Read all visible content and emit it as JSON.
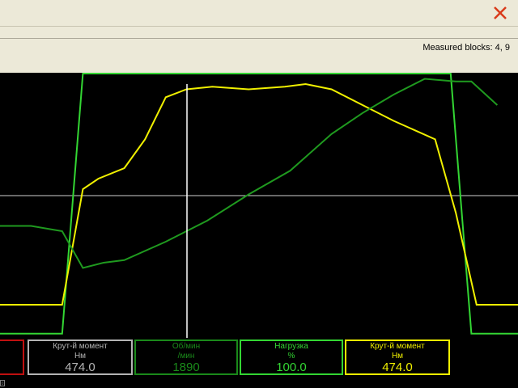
{
  "window": {
    "close_icon": "close-icon",
    "close_color": "#d93a1a"
  },
  "infobar": {
    "measured_blocks": "Measured blocks: 4, 9"
  },
  "colors": {
    "background": "#000000",
    "series_green": "#1f9a1f",
    "series_bright_green": "#33d633",
    "series_yellow": "#f0f000",
    "crosshair": "#ffffff",
    "grid": "#cfcfcf"
  },
  "gauges": [
    {
      "label": "",
      "unit": "",
      "value": "",
      "color": "#c01010"
    },
    {
      "label": "Крут-й момент",
      "unit": "Нм",
      "value": "474.0",
      "color": "#b4b4b4"
    },
    {
      "label": "Об/мин",
      "unit": "/мин",
      "value": "1890",
      "color": "#1a8a1a"
    },
    {
      "label": "Нагрузка",
      "unit": "%",
      "value": "100.0",
      "color": "#33d633"
    },
    {
      "label": "Крут-й момент",
      "unit": "Нм",
      "value": "474.0",
      "color": "#f0f000"
    }
  ],
  "tiny_label": "0",
  "chart_data": {
    "type": "line",
    "x_range": [
      0,
      100
    ],
    "y_range": [
      0,
      100
    ],
    "series": [
      {
        "color": "#33d633",
        "x": [
          0,
          12,
          16,
          87,
          91,
          100
        ],
        "y": [
          1,
          1,
          100,
          100,
          1,
          1
        ]
      },
      {
        "color": "#f0f000",
        "x": [
          0,
          12,
          16,
          19,
          24,
          28,
          32,
          36,
          41,
          48,
          55,
          59,
          64,
          70,
          76,
          84,
          88,
          92,
          100
        ],
        "y": [
          12,
          12,
          56,
          60,
          64,
          75,
          91,
          94,
          95,
          94,
          95,
          96,
          94,
          88,
          82,
          75,
          47,
          12,
          12
        ]
      },
      {
        "color": "#1f9a1f",
        "x": [
          0,
          6,
          12,
          16,
          20,
          24,
          32,
          40,
          48,
          56,
          64,
          70,
          76,
          82,
          88,
          91,
          96
        ],
        "y": [
          42,
          42,
          40,
          26,
          28,
          29,
          36,
          44,
          54,
          63,
          77,
          85,
          92,
          98,
          97,
          97,
          88
        ]
      }
    ]
  }
}
